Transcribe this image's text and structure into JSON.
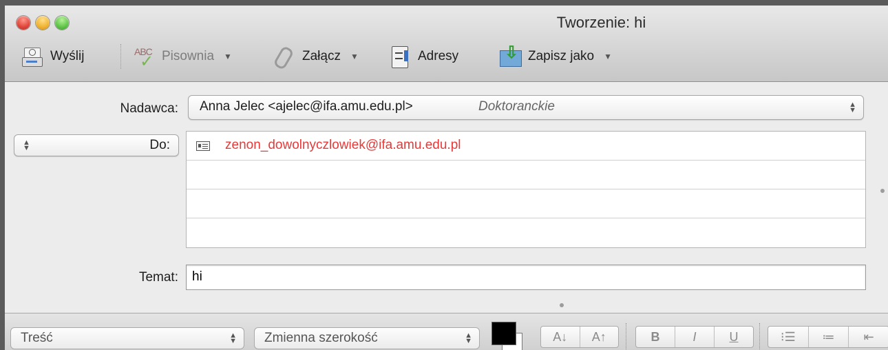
{
  "window": {
    "title": "Tworzenie: hi"
  },
  "toolbar": {
    "send": "Wyślij",
    "spelling": "Pisownia",
    "attach": "Załącz",
    "addresses": "Adresy",
    "save_as": "Zapisz jako"
  },
  "header": {
    "from_label": "Nadawca:",
    "from_value": "Anna Jelec <ajelec@ifa.amu.edu.pl>",
    "from_account": "Doktoranckie",
    "to_label": "Do:",
    "recipients": [
      "zenon_dowolnyczlowiek@ifa.amu.edu.pl"
    ],
    "subject_label": "Temat:",
    "subject_value": "hi"
  },
  "format_bar": {
    "style": "Treść",
    "width": "Zmienna szerokość",
    "text_color": "#000000",
    "font_smaller": "A↓",
    "font_larger": "A↑",
    "bold": "B",
    "italic": "I",
    "underline": "U"
  }
}
